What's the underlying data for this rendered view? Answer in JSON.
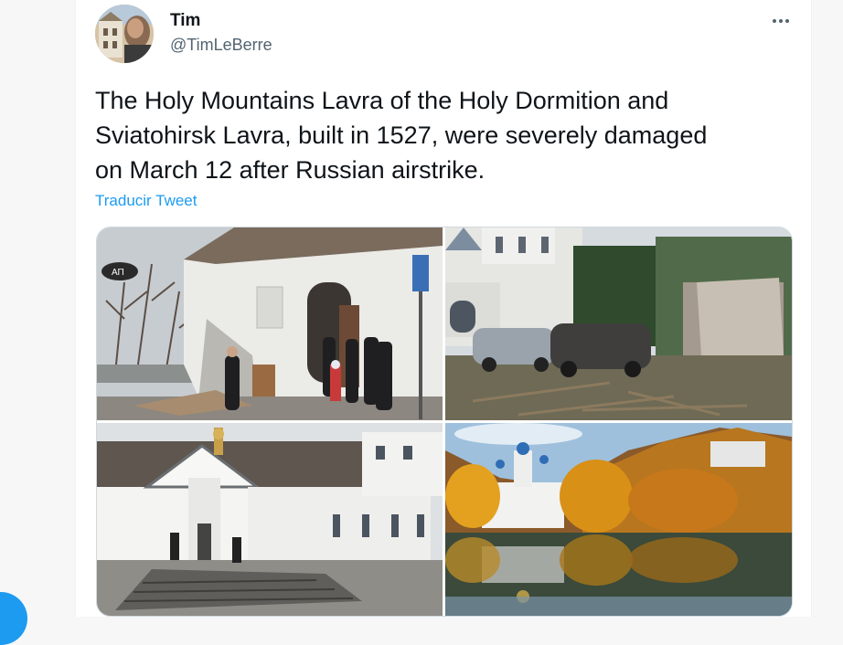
{
  "tweet": {
    "display_name": "Tim",
    "handle": "@TimLeBerre",
    "text": "The Holy Mountains Lavra of the Holy Dormition and\nSviatohirsk Lavra, built in 1527, were severely damaged\non March 12 after Russian airstrike.",
    "translate_label": "Traducir Tweet"
  },
  "media": {
    "sign_text": "АП"
  },
  "colors": {
    "link": "#1d9bf0",
    "secondary_text": "#536471",
    "primary_text": "#0f1419"
  },
  "icons": {
    "more": "more-options-icon",
    "compose": "compose-fab-icon"
  }
}
